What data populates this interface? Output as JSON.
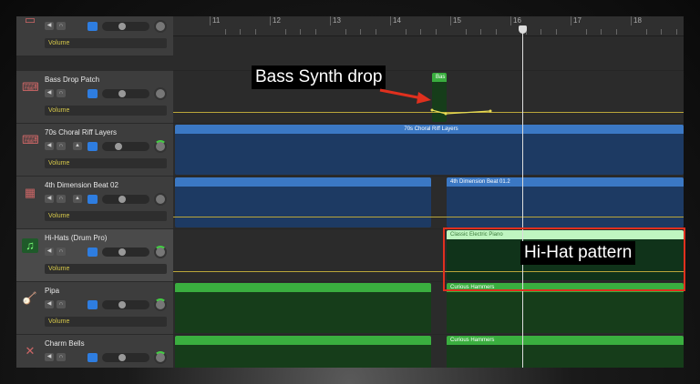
{
  "toolbar": {
    "add_label": "+",
    "automation_icon": "automation-curve-icon",
    "smart_icon": "catch-icon"
  },
  "ruler": {
    "bars": [
      "11",
      "12",
      "13",
      "14",
      "15",
      "16",
      "17",
      "18"
    ]
  },
  "tracks": [
    {
      "name": "",
      "automation": "Volume",
      "icon": "synth-icon"
    },
    {
      "name": "Bass Drop Patch",
      "automation": "Volume",
      "icon": "keyboard-icon"
    },
    {
      "name": "70s Choral Riff Layers",
      "automation": "Volume",
      "icon": "keyboard-icon"
    },
    {
      "name": "4th Dimension Beat 02",
      "automation": "Volume",
      "icon": "drum-machine-icon"
    },
    {
      "name": "Hi-Hats (Drum Pro)",
      "automation": "Volume",
      "icon": "music-note-icon"
    },
    {
      "name": "Pipa",
      "automation": "Volume",
      "icon": "pipa-icon"
    },
    {
      "name": "Charm Bells",
      "automation": "",
      "icon": "bells-icon"
    }
  ],
  "regions": {
    "bass_drop": "Bas",
    "choral": "70s Choral Riff Layers",
    "beat2": "4th Dimension Beat 01.2",
    "piano": "Classic Electric Piano",
    "hammers1": "Curious Hammers",
    "hammers2": "Curious Hammers"
  },
  "annotations": {
    "bass": "Bass Synth drop",
    "hihat": "Hi-Hat pattern",
    "highlight_color": "#e0301e"
  },
  "colors": {
    "audio_region": "#3b78c4",
    "midi_region": "#3aae3f",
    "automation": "#d6c84a"
  }
}
